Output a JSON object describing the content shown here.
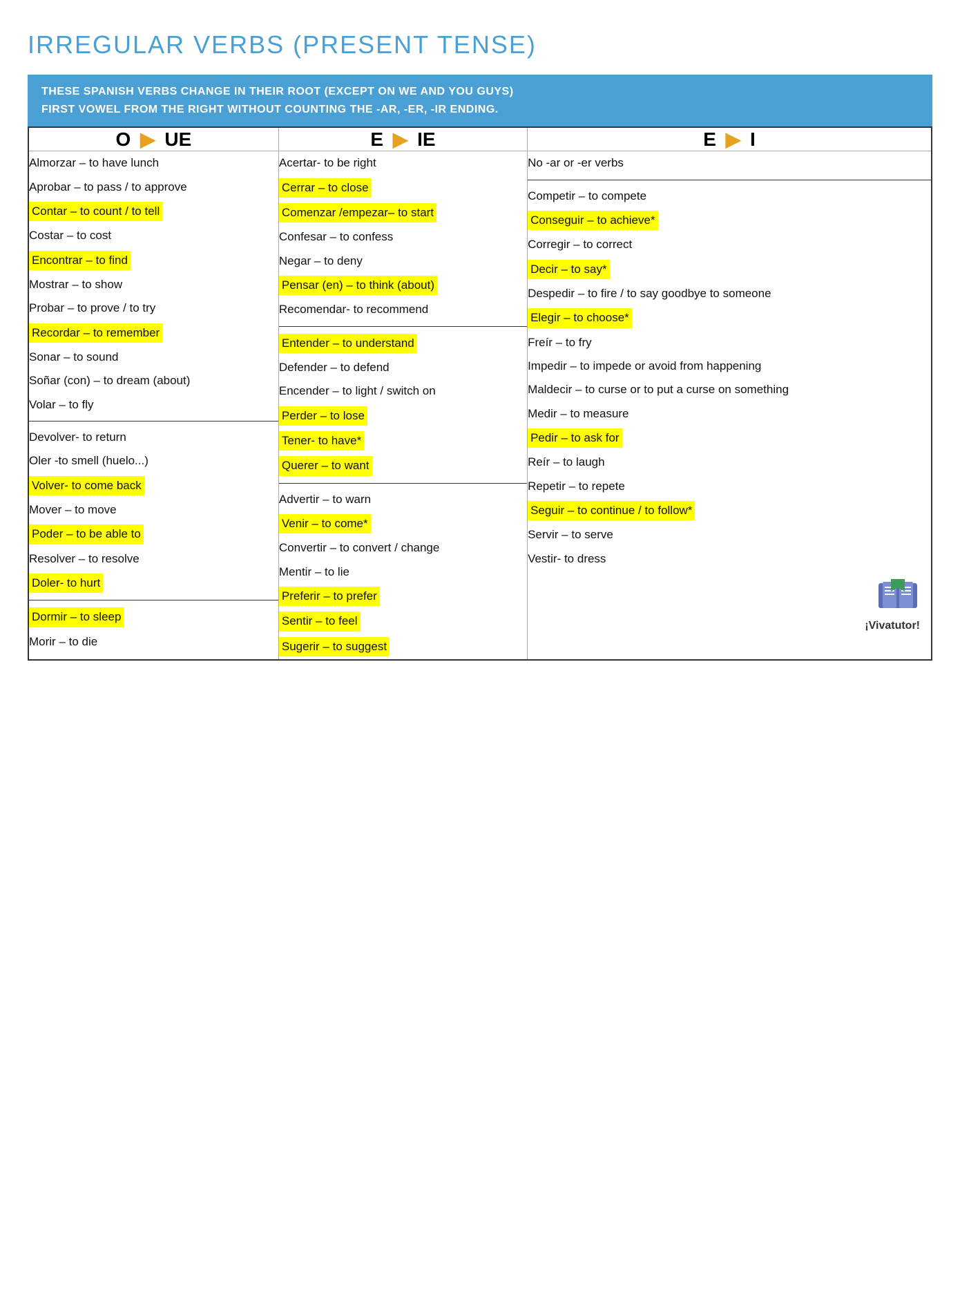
{
  "title": {
    "main": "IRREGULAR VERBS",
    "sub": " (PRESENT TENSE)"
  },
  "info": {
    "line1": "THESE SPANISH VERBS CHANGE IN THEIR ROOT (EXCEPT ON WE AND YOU GUYS)",
    "line2": "FIRST VOWEL FROM THE RIGHT WITHOUT COUNTING THE -AR, -ER, -IR ENDING."
  },
  "columns": [
    {
      "id": "col1",
      "header_from": "O",
      "header_to": "UE",
      "items": [
        {
          "text": "Almorzar – to have lunch",
          "highlight": false,
          "divider_before": false
        },
        {
          "text": "Aprobar – to pass / to approve",
          "highlight": false,
          "divider_before": false
        },
        {
          "text": "Contar – to count / to tell",
          "highlight": true,
          "divider_before": false
        },
        {
          "text": "Costar – to cost",
          "highlight": false,
          "divider_before": false
        },
        {
          "text": "Encontrar – to find",
          "highlight": true,
          "divider_before": false
        },
        {
          "text": "Mostrar – to show",
          "highlight": false,
          "divider_before": false
        },
        {
          "text": "Probar – to prove / to try",
          "highlight": false,
          "divider_before": false
        },
        {
          "text": "Recordar – to remember",
          "highlight": true,
          "divider_before": false
        },
        {
          "text": "Sonar – to sound",
          "highlight": false,
          "divider_before": false
        },
        {
          "text": "Soñar (con) – to dream (about)",
          "highlight": false,
          "divider_before": false
        },
        {
          "text": "Volar – to fly",
          "highlight": false,
          "divider_before": false
        },
        {
          "text": "Devolver- to return",
          "highlight": false,
          "divider_before": true
        },
        {
          "text": "Oler -to smell  (huelo...)",
          "highlight": false,
          "divider_before": false
        },
        {
          "text": "Volver- to come back",
          "highlight": true,
          "divider_before": false
        },
        {
          "text": "Mover – to move",
          "highlight": false,
          "divider_before": false
        },
        {
          "text": "Poder – to be able to",
          "highlight": true,
          "divider_before": false
        },
        {
          "text": "Resolver – to resolve",
          "highlight": false,
          "divider_before": false
        },
        {
          "text": "Doler- to hurt",
          "highlight": true,
          "divider_before": false
        },
        {
          "text": "Dormir – to sleep",
          "highlight": true,
          "divider_before": true
        },
        {
          "text": "Morir – to die",
          "highlight": false,
          "divider_before": false
        }
      ]
    },
    {
      "id": "col2",
      "header_from": "E",
      "header_to": "IE",
      "items": [
        {
          "text": "Acertar- to be right",
          "highlight": false,
          "divider_before": false
        },
        {
          "text": "Cerrar – to close",
          "highlight": true,
          "divider_before": false
        },
        {
          "text": "Comenzar /empezar– to start",
          "highlight": true,
          "divider_before": false
        },
        {
          "text": "Confesar – to confess",
          "highlight": false,
          "divider_before": false
        },
        {
          "text": "Negar – to deny",
          "highlight": false,
          "divider_before": false
        },
        {
          "text": "Pensar (en) – to think (about)",
          "highlight": true,
          "divider_before": false
        },
        {
          "text": "Recomendar- to recommend",
          "highlight": false,
          "divider_before": false
        },
        {
          "text": "Entender – to understand",
          "highlight": true,
          "divider_before": true
        },
        {
          "text": "Defender – to defend",
          "highlight": false,
          "divider_before": false
        },
        {
          "text": "Encender – to light / switch on",
          "highlight": false,
          "divider_before": false
        },
        {
          "text": "Perder – to lose",
          "highlight": true,
          "divider_before": false
        },
        {
          "text": "Tener- to have*",
          "highlight": true,
          "divider_before": false
        },
        {
          "text": "Querer – to want",
          "highlight": true,
          "divider_before": false
        },
        {
          "text": "Advertir – to warn",
          "highlight": false,
          "divider_before": true
        },
        {
          "text": "Venir – to come*",
          "highlight": true,
          "divider_before": false
        },
        {
          "text": "Convertir – to convert / change",
          "highlight": false,
          "divider_before": false
        },
        {
          "text": "Mentir – to lie",
          "highlight": false,
          "divider_before": false
        },
        {
          "text": "Preferir – to prefer",
          "highlight": true,
          "divider_before": false
        },
        {
          "text": "Sentir – to feel",
          "highlight": true,
          "divider_before": false
        },
        {
          "text": "Sugerir – to suggest",
          "highlight": true,
          "divider_before": false
        }
      ]
    },
    {
      "id": "col3",
      "header_from": "E",
      "header_to": "I",
      "items": [
        {
          "text": "No -ar or -er verbs",
          "highlight": false,
          "divider_before": false
        },
        {
          "text": "Competir – to compete",
          "highlight": false,
          "divider_before": true
        },
        {
          "text": "Conseguir – to achieve*",
          "highlight": true,
          "divider_before": false
        },
        {
          "text": "Corregir – to correct",
          "highlight": false,
          "divider_before": false
        },
        {
          "text": "Decir – to say*",
          "highlight": true,
          "divider_before": false
        },
        {
          "text": "Despedir – to fire / to say goodbye to someone",
          "highlight": false,
          "divider_before": false
        },
        {
          "text": "Elegir – to choose*",
          "highlight": true,
          "divider_before": false
        },
        {
          "text": "Freír – to fry",
          "highlight": false,
          "divider_before": false
        },
        {
          "text": "Impedir – to impede or avoid from happening",
          "highlight": false,
          "divider_before": false
        },
        {
          "text": "Maldecir –  to curse or to put a curse on something",
          "highlight": false,
          "divider_before": false
        },
        {
          "text": "Medir – to measure",
          "highlight": false,
          "divider_before": false
        },
        {
          "text": "Pedir – to ask for",
          "highlight": true,
          "divider_before": false
        },
        {
          "text": "Reír – to laugh",
          "highlight": false,
          "divider_before": false
        },
        {
          "text": "Repetir – to repete",
          "highlight": false,
          "divider_before": false
        },
        {
          "text": "Seguir – to continue / to follow*",
          "highlight": true,
          "divider_before": false
        },
        {
          "text": "Servir – to serve",
          "highlight": false,
          "divider_before": false
        },
        {
          "text": "Vestir- to dress",
          "highlight": false,
          "divider_before": false
        }
      ]
    }
  ],
  "vivatutor": "¡Vivatutor!"
}
